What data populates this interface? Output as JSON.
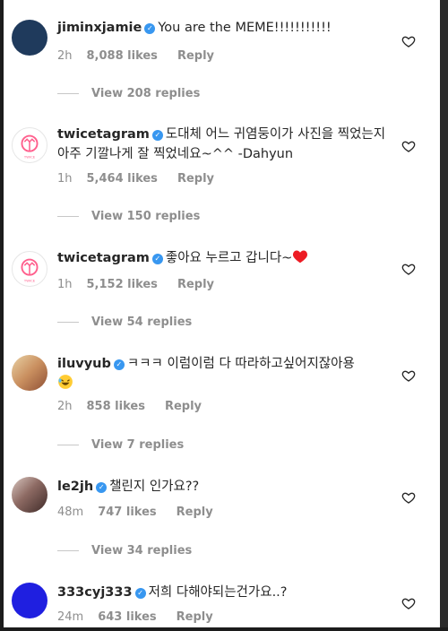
{
  "comments": [
    {
      "username": "jiminxjamie",
      "text": "You are the MEME!!!!!!!!!!!",
      "time": "2h",
      "likes": "8,088 likes",
      "reply": "Reply",
      "view_replies": "View 208 replies",
      "avatar": "dark-avatar"
    },
    {
      "username": "twicetagram",
      "text": "도대체 어느 귀염둥이가 사진을 찍었는지 아주 기깔나게 잘 찍었네요~^^ -Dahyun",
      "time": "1h",
      "likes": "5,464 likes",
      "reply": "Reply",
      "view_replies": "View 150 replies",
      "avatar": "twice-logo"
    },
    {
      "username": "twicetagram",
      "text": "좋아요 누르고 갑니다~",
      "time": "1h",
      "likes": "5,152 likes",
      "reply": "Reply",
      "view_replies": "View 54 replies",
      "avatar": "twice-logo",
      "emoji": "red-heart-emoji"
    },
    {
      "username": "iluvyub",
      "text": "ㅋㅋㅋ 이럼이럼 다 따라하고싶어지잖아용",
      "time": "2h",
      "likes": "858 likes",
      "reply": "Reply",
      "view_replies": "View 7 replies",
      "avatar": "photo",
      "emoji": "laughing-face-emoji"
    },
    {
      "username": "le2jh",
      "text": "챌린지 인가요??",
      "time": "48m",
      "likes": "747 likes",
      "reply": "Reply",
      "view_replies": "View 34 replies",
      "avatar": "photo"
    },
    {
      "username": "333cyj333",
      "text": "저희 다해야되는건가요..?",
      "time": "24m",
      "likes": "643 likes",
      "reply": "Reply",
      "avatar": "blue-avatar"
    }
  ],
  "colors": {
    "verified": "#3897f0",
    "meta": "#8e8e8e",
    "heart_emoji": "#ed1c24"
  }
}
